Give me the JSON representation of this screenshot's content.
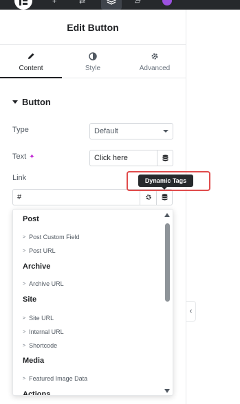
{
  "panel": {
    "title": "Edit Button"
  },
  "tabs": [
    {
      "label": "Content",
      "icon": "pencil-icon"
    },
    {
      "label": "Style",
      "icon": "half-circle-icon"
    },
    {
      "label": "Advanced",
      "icon": "gear-icon"
    }
  ],
  "section": {
    "title": "Button"
  },
  "controls": {
    "type_label": "Type",
    "type_value": "Default",
    "text_label": "Text",
    "text_value": "Click here",
    "link_label": "Link",
    "link_value": "#"
  },
  "tooltip": {
    "text": "Dynamic Tags"
  },
  "dropdown": {
    "groups": [
      {
        "label": "Post",
        "items": [
          "Post Custom Field",
          "Post URL"
        ]
      },
      {
        "label": "Archive",
        "items": [
          "Archive URL"
        ]
      },
      {
        "label": "Site",
        "items": [
          "Site URL",
          "Internal URL",
          "Shortcode"
        ]
      },
      {
        "label": "Media",
        "items": [
          "Featured Image Data"
        ]
      },
      {
        "label": "Actions",
        "items": []
      }
    ]
  },
  "colors": {
    "highlight": "#e04b4b",
    "accent": "#1f2124",
    "ai": "#c026d3"
  }
}
